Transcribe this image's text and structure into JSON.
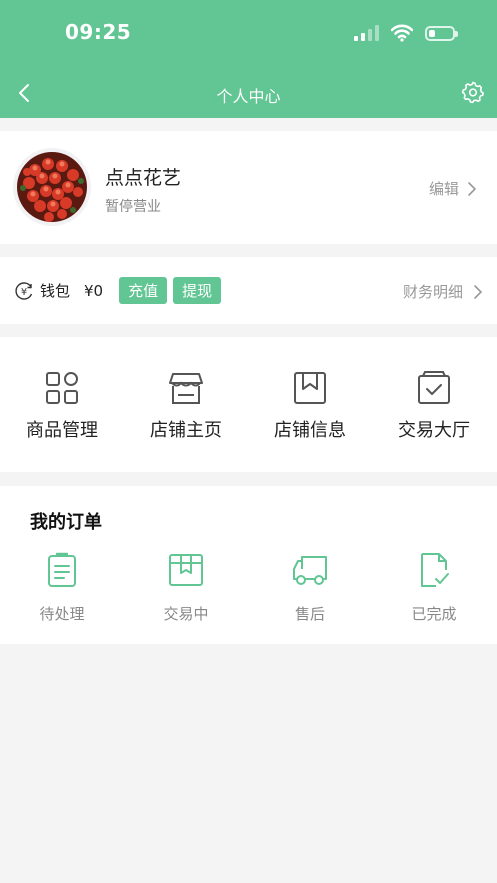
{
  "status_bar": {
    "time": "09:25"
  },
  "nav": {
    "title": "个人中心"
  },
  "profile": {
    "shop_name": "点点花艺",
    "status": "暂停营业",
    "edit_label": "编辑"
  },
  "wallet": {
    "label": "钱包",
    "amount": "¥0",
    "recharge_label": "充值",
    "withdraw_label": "提现",
    "finance_label": "财务明细"
  },
  "menu": {
    "items": [
      {
        "label": "商品管理",
        "icon": "grid-icon"
      },
      {
        "label": "店铺主页",
        "icon": "storefront-icon"
      },
      {
        "label": "店铺信息",
        "icon": "bookmark-box-icon"
      },
      {
        "label": "交易大厅",
        "icon": "checked-box-icon"
      }
    ]
  },
  "orders": {
    "title": "我的订单",
    "items": [
      {
        "label": "待处理",
        "icon": "clipboard-icon"
      },
      {
        "label": "交易中",
        "icon": "package-icon"
      },
      {
        "label": "售后",
        "icon": "truck-icon"
      },
      {
        "label": "已完成",
        "icon": "document-check-icon"
      }
    ]
  },
  "colors": {
    "primary": "#62c594",
    "background": "#f4f4f4",
    "icon_gray": "#555555"
  }
}
